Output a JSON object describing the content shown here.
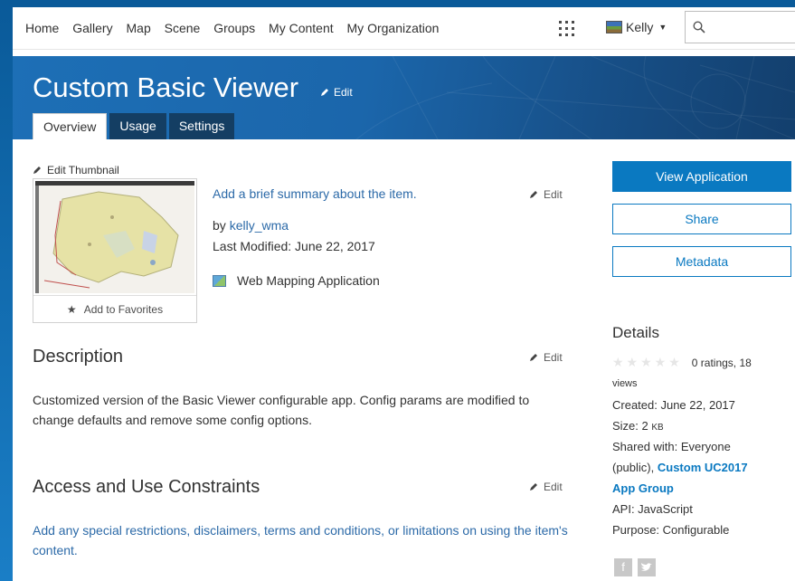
{
  "nav": {
    "links": [
      "Home",
      "Gallery",
      "Map",
      "Scene",
      "Groups",
      "My Content",
      "My Organization"
    ],
    "user_name": "Kelly",
    "search_placeholder": ""
  },
  "item": {
    "title": "Custom Basic Viewer",
    "title_edit": "Edit",
    "tabs": [
      "Overview",
      "Usage",
      "Settings"
    ],
    "active_tab": "Overview"
  },
  "thumbnail": {
    "edit_label": "Edit Thumbnail",
    "favorites_label": "Add to Favorites"
  },
  "summary": {
    "text": "Add a brief summary about the item.",
    "edit_label": "Edit",
    "by_label": "by",
    "owner": "kelly_wma",
    "last_modified": "Last Modified: June 22, 2017",
    "app_type": "Web Mapping Application"
  },
  "description": {
    "heading": "Description",
    "edit_label": "Edit",
    "text": "Customized version of the Basic Viewer configurable app. Config params are modified to change defaults and remove some config options."
  },
  "constraints": {
    "heading": "Access and Use Constraints",
    "edit_label": "Edit",
    "text": "Add any special restrictions, disclaimers, terms and conditions, or limitations on using the item's content."
  },
  "actions": {
    "view_application": "View Application",
    "share": "Share",
    "metadata": "Metadata"
  },
  "details": {
    "title": "Details",
    "rating_text": "0 ratings, 18",
    "views_text": "views",
    "created": "Created: June 22, 2017",
    "size_label": "Size: 2",
    "size_unit": "KB",
    "shared_label": "Shared with:",
    "shared_everyone": "Everyone",
    "shared_public": "(public),",
    "group_link_1": "Custom UC2017",
    "group_link_2": "App Group",
    "api": "API: JavaScript",
    "purpose": "Purpose: Configurable"
  },
  "colors": {
    "accent": "#0a79c1",
    "banner": "#1b66ab",
    "tab_inactive": "#143e63",
    "link": "#2c6aa8"
  },
  "icons": [
    "apps-grid-icon",
    "search-icon",
    "pencil-icon",
    "star-icon",
    "web-app-icon",
    "facebook-icon",
    "twitter-icon"
  ]
}
